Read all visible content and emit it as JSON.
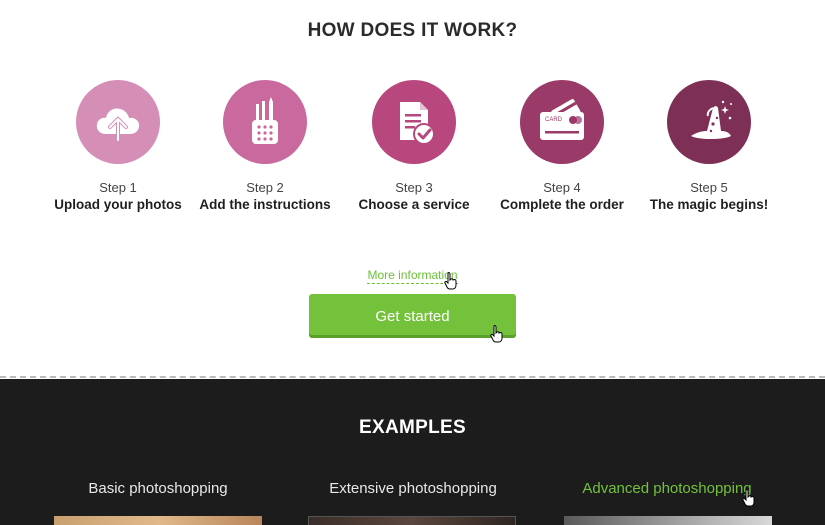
{
  "how_it_works": {
    "title": "HOW DOES IT WORK?",
    "steps": [
      {
        "num": "Step 1",
        "desc": "Upload your photos",
        "icon": "cloud-upload-icon",
        "color": "#d58fb6"
      },
      {
        "num": "Step 2",
        "desc": "Add the instructions",
        "icon": "pencil-cup-icon",
        "color": "#c9699d"
      },
      {
        "num": "Step 3",
        "desc": "Choose a service",
        "icon": "document-check-icon",
        "color": "#b8477e"
      },
      {
        "num": "Step 4",
        "desc": "Complete the order",
        "icon": "credit-card-icon",
        "color": "#9a3a68",
        "card_text": "CARD"
      },
      {
        "num": "Step 5",
        "desc": "The magic begins!",
        "icon": "wizard-hat-icon",
        "color": "#7e2f56"
      }
    ],
    "more_info_label": "More information",
    "get_started_label": "Get started"
  },
  "examples": {
    "title": "EXAMPLES",
    "tabs": [
      {
        "label": "Basic photoshopping",
        "active": false
      },
      {
        "label": "Extensive photoshopping",
        "active": false
      },
      {
        "label": "Advanced photoshopping",
        "active": true
      }
    ]
  },
  "colors": {
    "accent_green": "#74c23b",
    "dark_background": "#1c1c1c"
  }
}
